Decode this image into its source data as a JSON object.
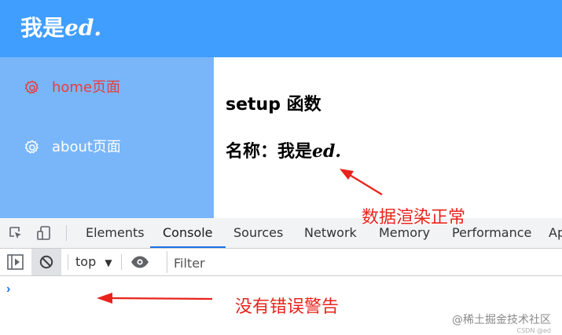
{
  "header": {
    "title_prefix": "我是",
    "title_suffix": "ed."
  },
  "sidebar": {
    "items": [
      {
        "label": "home页面",
        "icon": "gear-icon",
        "active": true
      },
      {
        "label": "about页面",
        "icon": "gear-icon",
        "active": false
      }
    ]
  },
  "main": {
    "heading": "setup 函数",
    "name_prefix": "名称：我是",
    "name_suffix": "ed."
  },
  "annotations": {
    "render_ok": "数据渲染正常",
    "no_errors": "没有错误警告"
  },
  "devtools": {
    "tabs": [
      "Elements",
      "Console",
      "Sources",
      "Network",
      "Memory",
      "Performance",
      "Ap"
    ],
    "active_tab": "Console",
    "context": "top",
    "filter_placeholder": "Filter",
    "prompt": "›"
  },
  "watermark": "@稀土掘金技术社区",
  "watermark_small": "CSDN @ed",
  "colors": {
    "header_bg": "#409eff",
    "sidebar_bg": "#78b6f9",
    "active_item": "#e83c3c",
    "annotation": "#e8231c",
    "devtools_accent": "#1a73e8"
  }
}
